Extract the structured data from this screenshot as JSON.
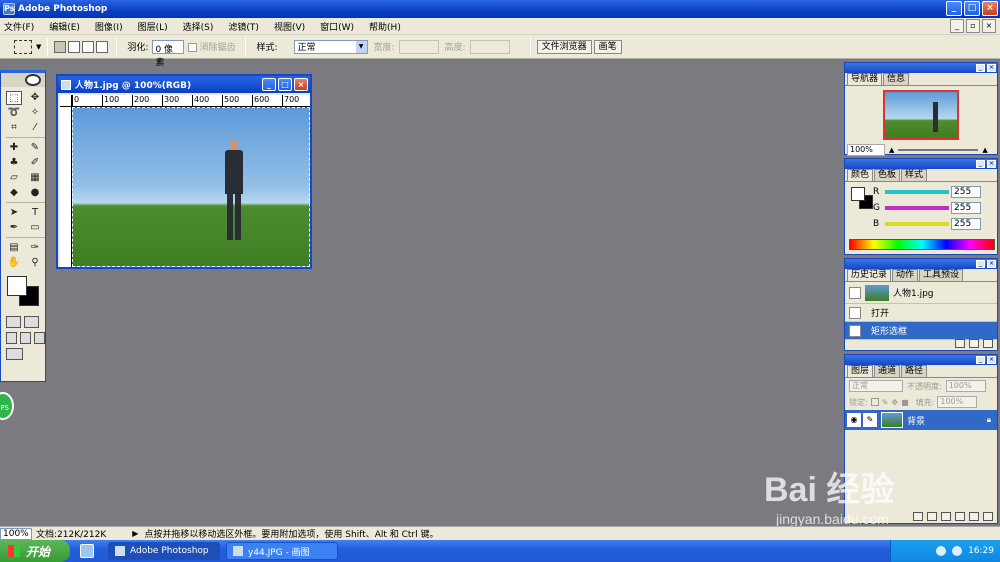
{
  "window": {
    "title": "Adobe Photoshop"
  },
  "menu": [
    "文件(F)",
    "编辑(E)",
    "图像(I)",
    "图层(L)",
    "选择(S)",
    "滤镜(T)",
    "视图(V)",
    "窗口(W)",
    "帮助(H)"
  ],
  "options": {
    "feather_label": "羽化:",
    "feather_value": "0 像素",
    "antialias_label": "消除锯齿",
    "style_label": "样式:",
    "style_value": "正常",
    "width_label": "宽度:",
    "height_label": "高度:",
    "well_tabs": [
      "文件浏览器",
      "画笔"
    ]
  },
  "document": {
    "title": "人物1.jpg @ 100%(RGB)",
    "ruler_marks": [
      "0",
      "100",
      "200",
      "300",
      "400",
      "500",
      "600",
      "700",
      "8"
    ]
  },
  "navigator": {
    "tabs": [
      "导航器",
      "信息"
    ],
    "zoom": "100%"
  },
  "color_panel": {
    "tabs": [
      "颜色",
      "色板",
      "样式"
    ],
    "channels": [
      {
        "label": "R",
        "value": "255",
        "color": "#22c6c6"
      },
      {
        "label": "G",
        "value": "255",
        "color": "#c22cc2"
      },
      {
        "label": "B",
        "value": "255",
        "color": "#d9d92c"
      }
    ]
  },
  "history": {
    "tabs": [
      "历史记录",
      "动作",
      "工具预设"
    ],
    "snapshot": "人物1.jpg",
    "items": [
      "打开",
      "矩形选框"
    ],
    "selected_index": 1
  },
  "layers": {
    "tabs": [
      "图层",
      "通道",
      "路径"
    ],
    "blend_mode": "正常",
    "opacity_label": "不透明度:",
    "opacity_value": "100%",
    "lock_label": "锁定:",
    "fill_label": "填充:",
    "fill_value": "100%",
    "layer_name": "背景"
  },
  "status": {
    "zoom": "100%",
    "doc_size": "文档:212K/212K",
    "hint": "点按并拖移以移动选区外框。要用附加选项，使用 Shift、Alt 和 Ctrl 键。"
  },
  "taskbar": {
    "start": "开始",
    "tasks": [
      "Adobe Photoshop",
      "y44.JPG - 画图"
    ],
    "clock": "16:29"
  },
  "watermark": {
    "line1": "Bai  经验",
    "line2": "jingyan.baidu.com"
  },
  "colors": {
    "titlebar": "#0a3fc4",
    "workspace": "#7b7a80",
    "selection": "#3169c6"
  }
}
